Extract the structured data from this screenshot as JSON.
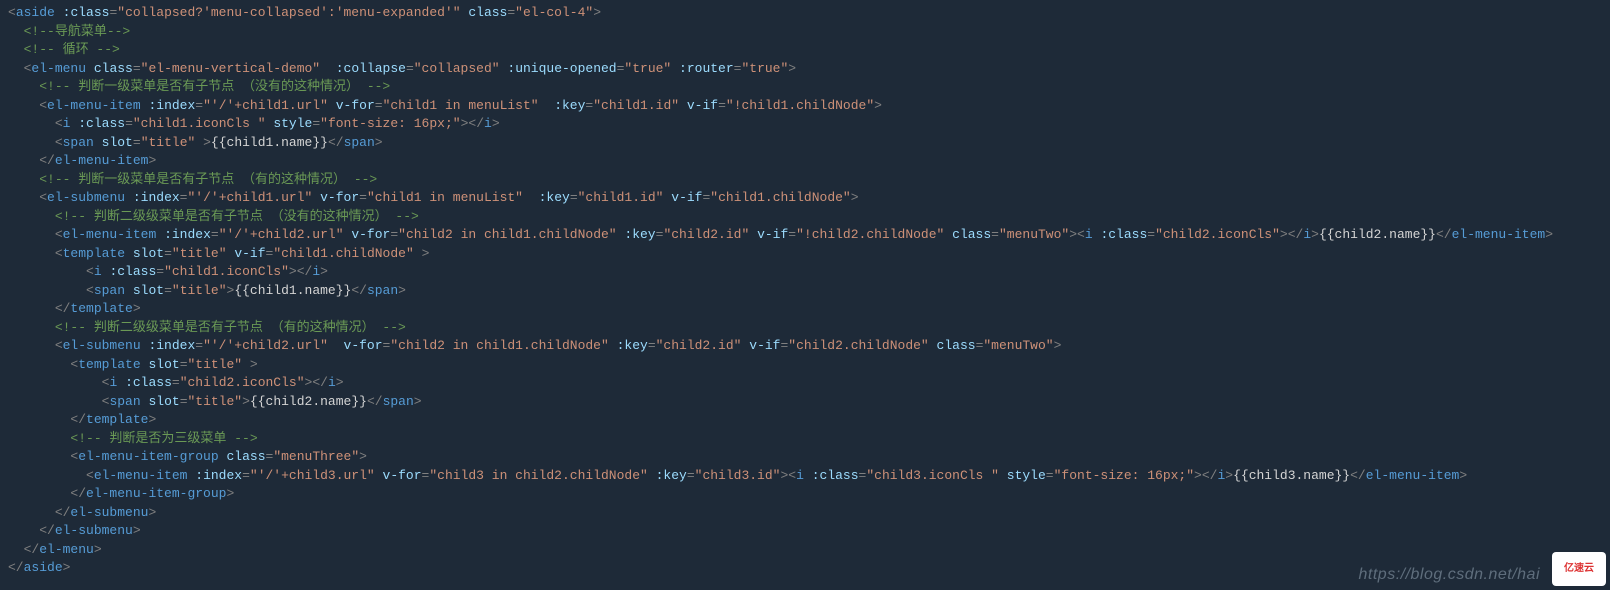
{
  "watermark": "https://blog.csdn.net/hai",
  "logo_text": "亿速云",
  "code": {
    "lines": [
      {
        "indent": 0,
        "type": "tag-open",
        "tag": "aside",
        "attrs": [
          [
            ":class",
            "collapsed?'menu-collapsed':'menu-expanded'"
          ],
          [
            "class",
            "el-col-4"
          ]
        ]
      },
      {
        "indent": 1,
        "type": "comment",
        "text": "导航菜单"
      },
      {
        "indent": 1,
        "type": "comment",
        "text": " 循环 "
      },
      {
        "indent": 1,
        "type": "tag-open",
        "tag": "el-menu",
        "attrs": [
          [
            "class",
            "el-menu-vertical-demo"
          ],
          [
            " :collapse",
            "collapsed"
          ],
          [
            ":unique-opened",
            "true"
          ],
          [
            ":router",
            "true"
          ]
        ]
      },
      {
        "indent": 2,
        "type": "comment",
        "text": " 判断一级菜单是否有子节点 （没有的这种情况） "
      },
      {
        "indent": 2,
        "type": "tag-open",
        "tag": "el-menu-item",
        "attrs": [
          [
            ":index",
            "'/'+child1.url"
          ],
          [
            "v-for",
            "child1 in menuList"
          ],
          [
            " :key",
            "child1.id"
          ],
          [
            "v-if",
            "!child1.childNode"
          ]
        ]
      },
      {
        "indent": 3,
        "type": "tag-full",
        "tag": "i",
        "attrs": [
          [
            ":class",
            "child1.iconCls "
          ],
          [
            "style",
            "font-size: 16px;"
          ]
        ],
        "inner": ""
      },
      {
        "indent": 3,
        "type": "tag-full",
        "tag": "span",
        "attrs": [
          [
            "slot",
            "title"
          ]
        ],
        "inner": "{{child1.name}}",
        "space_before_close": true
      },
      {
        "indent": 2,
        "type": "tag-close",
        "tag": "el-menu-item"
      },
      {
        "indent": 2,
        "type": "comment",
        "text": " 判断一级菜单是否有子节点 （有的这种情况） "
      },
      {
        "indent": 2,
        "type": "tag-open",
        "tag": "el-submenu",
        "attrs": [
          [
            ":index",
            "'/'+child1.url"
          ],
          [
            "v-for",
            "child1 in menuList"
          ],
          [
            " :key",
            "child1.id"
          ],
          [
            "v-if",
            "child1.childNode"
          ]
        ]
      },
      {
        "indent": 3,
        "type": "comment",
        "text": " 判断二级级菜单是否有子节点 （没有的这种情况） "
      },
      {
        "indent": 3,
        "type": "long-line1"
      },
      {
        "indent": 3,
        "type": "tag-open",
        "tag": "template",
        "attrs": [
          [
            "slot",
            "title"
          ],
          [
            "v-if",
            "child1.childNode"
          ]
        ],
        "space_before_close": true
      },
      {
        "indent": 5,
        "type": "tag-full",
        "tag": "i",
        "attrs": [
          [
            ":class",
            "child1.iconCls"
          ]
        ],
        "inner": ""
      },
      {
        "indent": 5,
        "type": "tag-full",
        "tag": "span",
        "attrs": [
          [
            "slot",
            "title"
          ]
        ],
        "inner": "{{child1.name}}"
      },
      {
        "indent": 3,
        "type": "tag-close",
        "tag": "template"
      },
      {
        "indent": 3,
        "type": "comment",
        "text": " 判断二级级菜单是否有子节点 （有的这种情况） "
      },
      {
        "indent": 3,
        "type": "tag-open",
        "tag": "el-submenu",
        "attrs": [
          [
            ":index",
            "'/'+child2.url"
          ],
          [
            " v-for",
            "child2 in child1.childNode"
          ],
          [
            ":key",
            "child2.id"
          ],
          [
            "v-if",
            "child2.childNode"
          ],
          [
            "class",
            "menuTwo"
          ]
        ]
      },
      {
        "indent": 4,
        "type": "tag-open",
        "tag": "template",
        "attrs": [
          [
            "slot",
            "title"
          ]
        ],
        "space_before_close": true
      },
      {
        "indent": 6,
        "type": "tag-full",
        "tag": "i",
        "attrs": [
          [
            ":class",
            "child2.iconCls"
          ]
        ],
        "inner": ""
      },
      {
        "indent": 6,
        "type": "tag-full",
        "tag": "span",
        "attrs": [
          [
            "slot",
            "title"
          ]
        ],
        "inner": "{{child2.name}}"
      },
      {
        "indent": 4,
        "type": "tag-close",
        "tag": "template"
      },
      {
        "indent": 4,
        "type": "comment",
        "text": " 判断是否为三级菜单 "
      },
      {
        "indent": 4,
        "type": "tag-open",
        "tag": "el-menu-item-group",
        "attrs": [
          [
            "class",
            "menuThree"
          ]
        ]
      },
      {
        "indent": 5,
        "type": "long-line2"
      },
      {
        "indent": 4,
        "type": "tag-close",
        "tag": "el-menu-item-group"
      },
      {
        "indent": 3,
        "type": "tag-close",
        "tag": "el-submenu"
      },
      {
        "indent": 2,
        "type": "tag-close",
        "tag": "el-submenu"
      },
      {
        "indent": 1,
        "type": "tag-close",
        "tag": "el-menu"
      },
      {
        "indent": 0,
        "type": "tag-close",
        "tag": "aside"
      }
    ],
    "long1": {
      "tag": "el-menu-item",
      "attrs": [
        [
          ":index",
          "'/'+child2.url"
        ],
        [
          "v-for",
          "child2 in child1.childNode"
        ],
        [
          ":key",
          "child2.id"
        ],
        [
          "v-if",
          "!child2.childNode"
        ],
        [
          "class",
          "menuTwo"
        ]
      ],
      "inner_i_attrs": [
        [
          ":class",
          "child2.iconCls"
        ]
      ],
      "inner_text": "{{child2.name}}"
    },
    "long2": {
      "tag": "el-menu-item",
      "attrs": [
        [
          ":index",
          "'/'+child3.url"
        ],
        [
          "v-for",
          "child3 in child2.childNode"
        ],
        [
          ":key",
          "child3.id"
        ]
      ],
      "inner_i_attrs": [
        [
          ":class",
          "child3.iconCls "
        ],
        [
          "style",
          "font-size: 16px;"
        ]
      ],
      "inner_text": "{{child3.name}}"
    }
  }
}
